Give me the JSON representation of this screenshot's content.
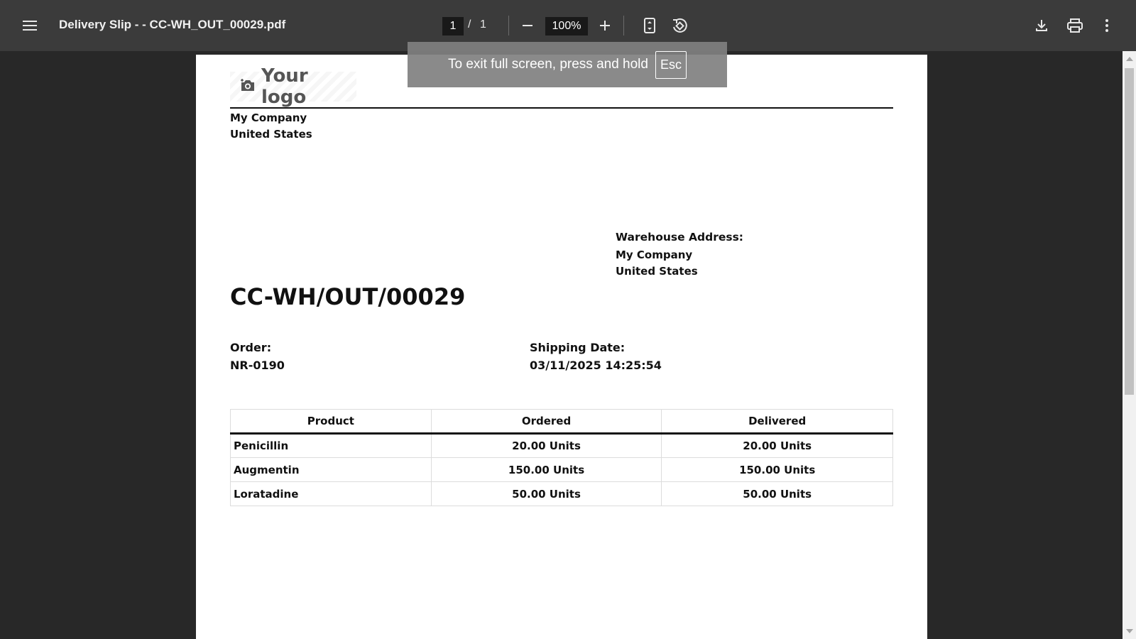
{
  "toolbar": {
    "title": "Delivery Slip - - CC-WH_OUT_00029.pdf",
    "page_current": "1",
    "page_separator": "/",
    "page_total": "1",
    "zoom": "100%",
    "icons": [
      "menu-icon",
      "minus-icon",
      "plus-icon",
      "fit-page-icon",
      "rotate-icon",
      "download-icon",
      "print-icon",
      "more-vert-icon"
    ]
  },
  "fullscreen_toast": {
    "message": "To exit full screen, press and hold",
    "key": "Esc"
  },
  "document": {
    "logo_text": "Your logo",
    "company_name": "My Company",
    "company_country": "United States",
    "warehouse_label": "Warehouse Address:",
    "warehouse_name": "My Company",
    "warehouse_country": "United States",
    "number": "CC-WH/OUT/00029",
    "order_label": "Order:",
    "order_value": "NR-0190",
    "shipping_date_label": "Shipping Date:",
    "shipping_date_value": "03/11/2025 14:25:54",
    "table": {
      "headers": [
        "Product",
        "Ordered",
        "Delivered"
      ],
      "rows": [
        {
          "product": "Penicillin",
          "ordered": "20.00 Units",
          "delivered": "20.00 Units"
        },
        {
          "product": "Augmentin",
          "ordered": "150.00 Units",
          "delivered": "150.00 Units"
        },
        {
          "product": "Loratadine",
          "ordered": "50.00 Units",
          "delivered": "50.00 Units"
        }
      ]
    }
  },
  "colors": {
    "toolbar_bg": "#3b3b3b",
    "viewer_bg": "#282828",
    "page_bg": "#ffffff",
    "toast_bg": "#808080"
  }
}
